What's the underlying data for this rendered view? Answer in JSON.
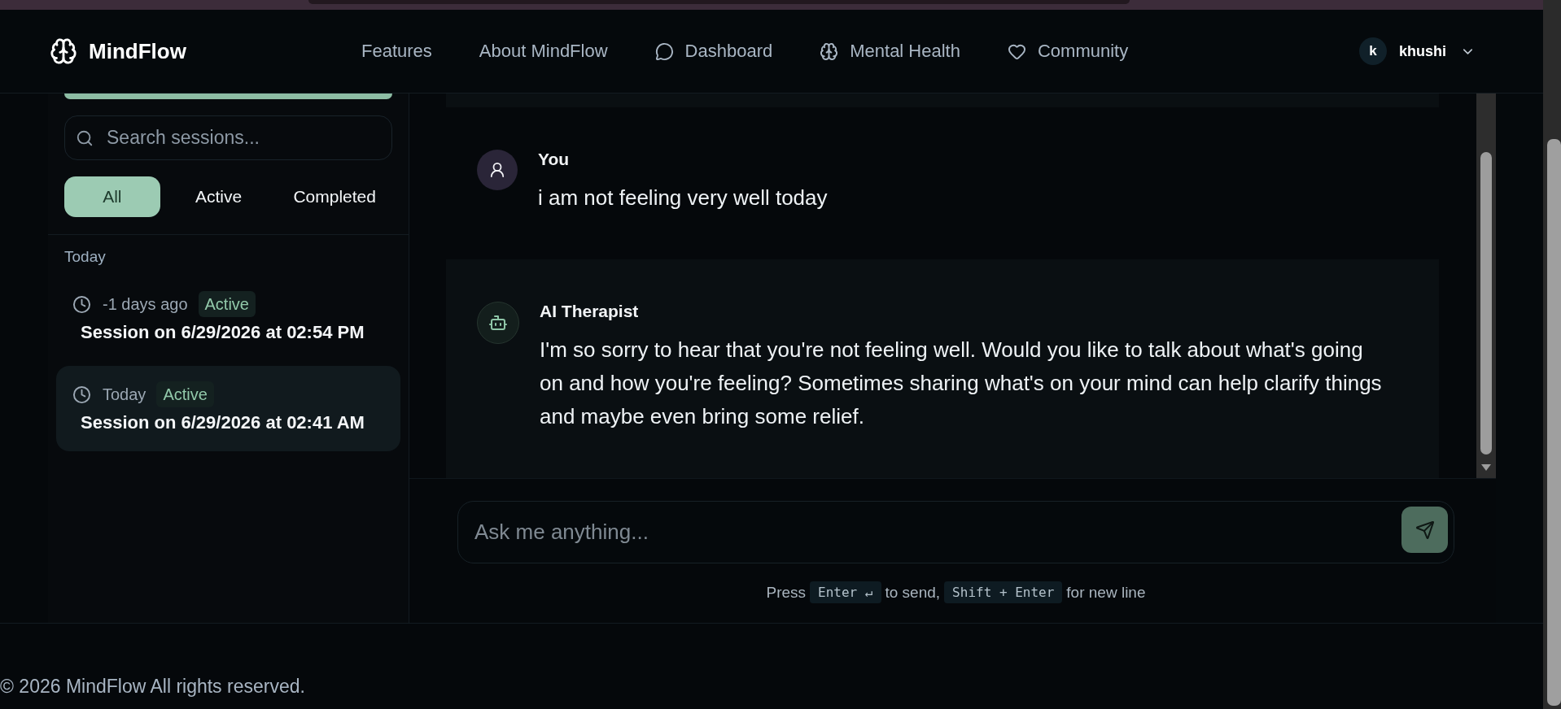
{
  "header": {
    "brand": "MindFlow",
    "nav": [
      {
        "label": "Features"
      },
      {
        "label": "About MindFlow"
      },
      {
        "label": "Dashboard"
      },
      {
        "label": "Mental Health"
      },
      {
        "label": "Community"
      }
    ],
    "user": {
      "initial": "k",
      "name": "khushi"
    }
  },
  "sidebar": {
    "search": {
      "placeholder": "Search sessions..."
    },
    "filters": [
      {
        "label": "All",
        "selected": true
      },
      {
        "label": "Active",
        "selected": false
      },
      {
        "label": "Completed",
        "selected": false
      }
    ],
    "groups": [
      {
        "label": "Today",
        "sessions": [
          {
            "time": "-1 days ago",
            "status": "Active",
            "title": "Session on 6/29/2026 at 02:54 PM",
            "selected": false
          },
          {
            "time": "Today",
            "status": "Active",
            "title": "Session on 6/29/2026 at 02:41 AM",
            "selected": true
          }
        ]
      }
    ]
  },
  "chat": {
    "messages": [
      {
        "kind": "user",
        "sender": "You",
        "text": "i am not feeling very well today"
      },
      {
        "kind": "assistant",
        "sender": "AI Therapist",
        "text": "I'm so sorry to hear that you're not feeling well. Would you like to talk about what's going on and how you're feeling? Sometimes sharing what's on your mind can help clarify things and maybe even bring some relief."
      }
    ],
    "input": {
      "placeholder": "Ask me anything..."
    },
    "hint": [
      {
        "kind": "text",
        "text": "Press"
      },
      {
        "kind": "key",
        "text": "Enter ↵"
      },
      {
        "kind": "text",
        "text": "to send,"
      },
      {
        "kind": "key",
        "text": "Shift + Enter"
      },
      {
        "kind": "text",
        "text": "for new line"
      }
    ]
  },
  "footer": {
    "text": "© 2026 MindFlow All rights reserved."
  }
}
